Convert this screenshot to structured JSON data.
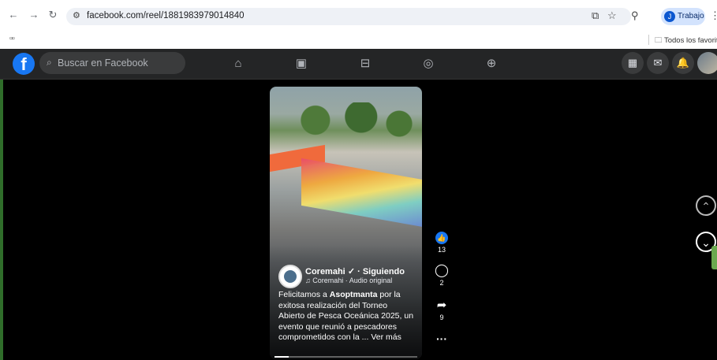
{
  "browser": {
    "url": "facebook.com/reel/1881983979014840",
    "profile_name": "Trabajo",
    "profile_initial": "J",
    "bookmark_folder": "Todos los favoritos"
  },
  "facebook": {
    "logo": "f",
    "search_placeholder": "Buscar en Facebook",
    "nav_icons": [
      "home-icon",
      "reels-icon",
      "marketplace-icon",
      "groups-icon",
      "gaming-icon"
    ]
  },
  "reel": {
    "author": "Coremahi",
    "verified": "✓",
    "follow": "· Siguiendo",
    "audio": "♫ Coremahi · Audio original",
    "caption_prefix": "Felicitamos a ",
    "caption_bold": "Asoptmanta",
    "caption_rest": " por la exitosa realización del Torneo Abierto de Pesca Oceánica 2025, un evento que reunió a pescadores comprometidos con la ... ",
    "see_more": "Ver más",
    "progress": 0.1
  },
  "actions": {
    "likes": "13",
    "comments": "2",
    "shares": "9"
  }
}
